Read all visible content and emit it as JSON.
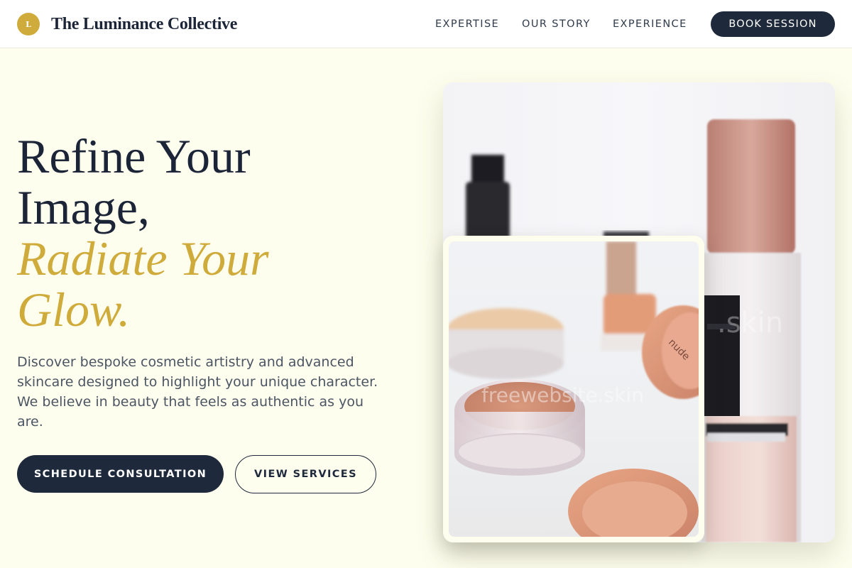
{
  "brand": {
    "logo_letter": "L",
    "name": "The Luminance Collective",
    "accent_color": "#cfab3c"
  },
  "nav": {
    "items": [
      {
        "label": "EXPERTISE"
      },
      {
        "label": "OUR STORY"
      },
      {
        "label": "EXPERIENCE"
      }
    ],
    "cta_label": "BOOK SESSION"
  },
  "hero": {
    "title_line1": "Refine Your",
    "title_line2": "Image,",
    "title_accent_line1": "Radiate Your",
    "title_accent_line2": "Glow.",
    "description": "Discover bespoke cosmetic artistry and advanced skincare designed to highlight your unique character. We believe in beauty that feels as authentic as you are.",
    "primary_button": "SCHEDULE CONSULTATION",
    "secondary_button": "VIEW SERVICES"
  },
  "images": {
    "main_watermark": ".skin",
    "inset_watermark": "freewebsite.skin",
    "inset_brand_lid": "nude"
  },
  "colors": {
    "navy": "#1e293b",
    "gold": "#cfab3c",
    "background": "#fefeee"
  }
}
